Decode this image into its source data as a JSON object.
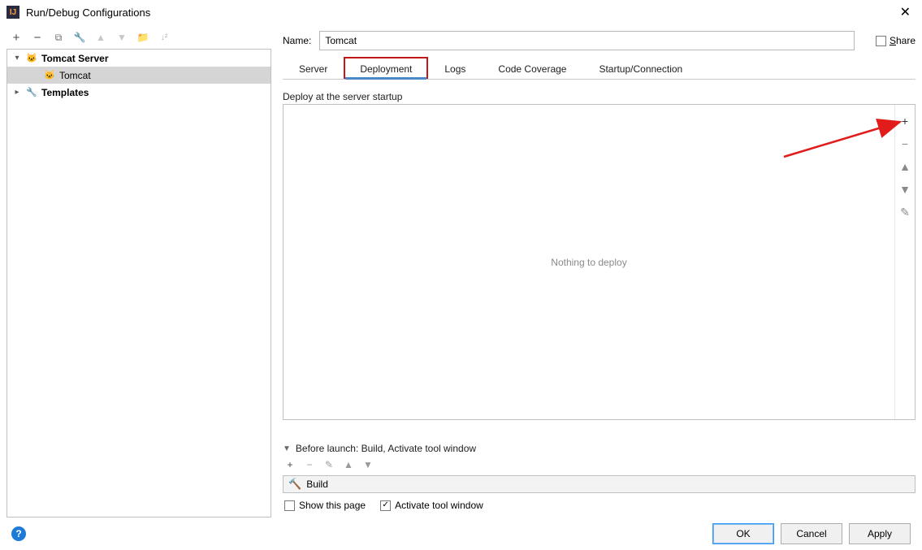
{
  "window": {
    "title": "Run/Debug Configurations"
  },
  "share_label": "Share",
  "name_label": "Name:",
  "name_value": "Tomcat",
  "tree": {
    "tomcat_server": "Tomcat Server",
    "tomcat_child": "Tomcat",
    "templates": "Templates"
  },
  "tabs": {
    "server": "Server",
    "deployment": "Deployment",
    "logs": "Logs",
    "code_coverage": "Code Coverage",
    "startup": "Startup/Connection"
  },
  "deploy": {
    "section_label": "Deploy at the server startup",
    "empty_text": "Nothing to deploy"
  },
  "before_launch": {
    "header": "Before launch: Build, Activate tool window",
    "item": "Build",
    "show_this_page": "Show this page",
    "activate_tool_window": "Activate tool window"
  },
  "buttons": {
    "ok": "OK",
    "cancel": "Cancel",
    "apply": "Apply"
  },
  "help_tooltip": "?"
}
